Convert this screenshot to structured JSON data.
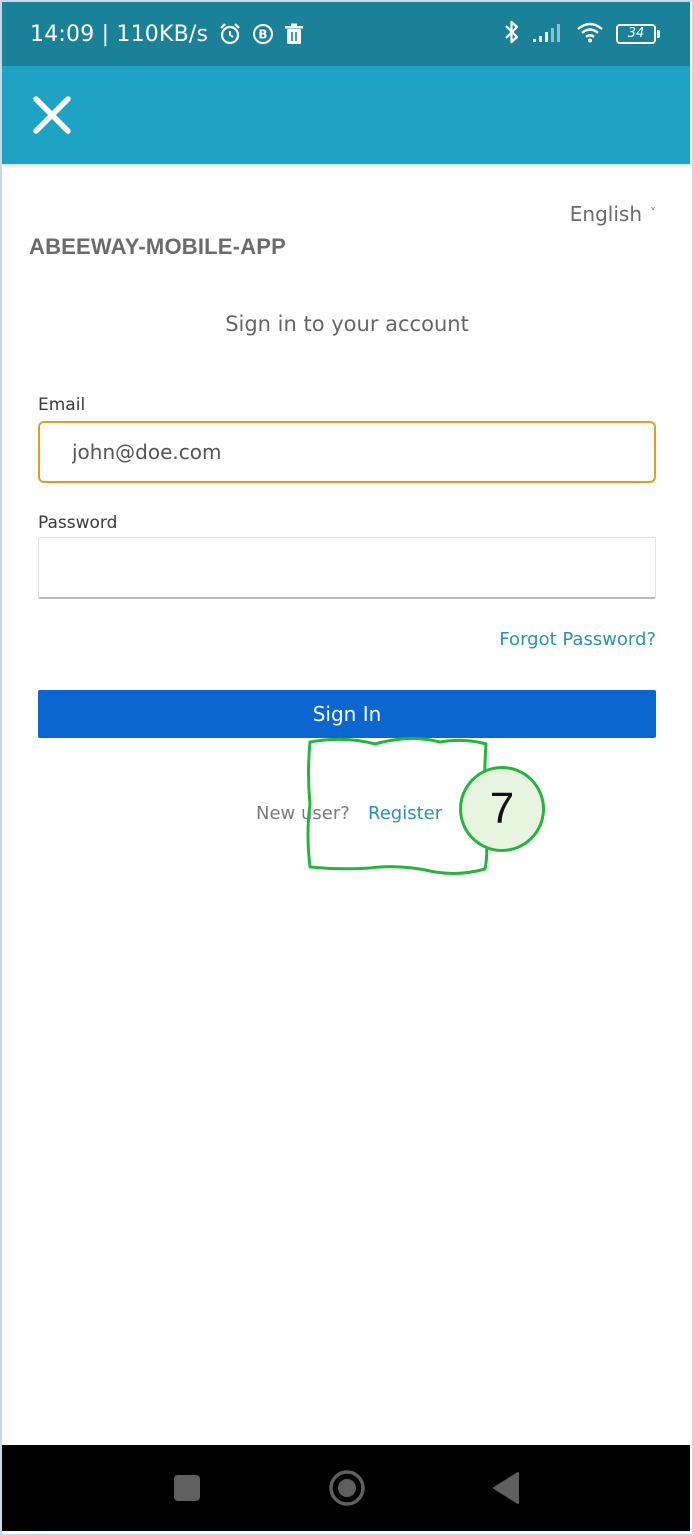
{
  "status_bar": {
    "time_and_speed": "14:09 | 110KB/s",
    "battery_level": "34",
    "icons": [
      "alarm-icon",
      "b-badge-icon",
      "trash-icon",
      "bluetooth-icon",
      "signal-icon",
      "wifi-icon",
      "battery-icon"
    ]
  },
  "app_bar": {
    "close_icon": "close-icon",
    "background": "#1fa3c4"
  },
  "language": {
    "selected": "English",
    "chevron": "˅"
  },
  "app_title": "ABEEWAY-MOBILE-APP",
  "login": {
    "subtitle": "Sign in to your account",
    "email_label": "Email",
    "email_value": "john@doe.com",
    "password_label": "Password",
    "password_value": "",
    "forgot_password": "Forgot Password?",
    "sign_in_button": "Sign In",
    "new_user_text": "New user?",
    "register_link": "Register"
  },
  "annotation": {
    "step_number": "7",
    "color": "#27b43e"
  },
  "colors": {
    "status_bar": "#1b8199",
    "primary_button": "#0b66cf",
    "link": "#2a8fbf",
    "focus_border": "#d9a02a"
  },
  "nav_bar": {
    "icons": [
      "recents-square-icon",
      "home-circle-icon",
      "back-triangle-icon"
    ]
  }
}
